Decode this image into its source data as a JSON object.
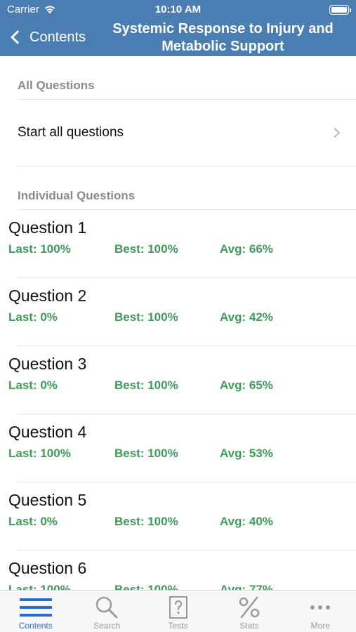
{
  "status_bar": {
    "carrier": "Carrier",
    "time": "10:10 AM"
  },
  "nav": {
    "back_label": "Contents",
    "title": "Systemic Response to Injury and Metabolic Support"
  },
  "sections": {
    "all_header": "All Questions",
    "start_all_label": "Start all questions",
    "individual_header": "Individual Questions"
  },
  "questions": [
    {
      "title": "Question 1",
      "last": "Last: 100%",
      "best": "Best: 100%",
      "avg": "Avg: 66%"
    },
    {
      "title": "Question 2",
      "last": "Last: 0%",
      "best": "Best: 100%",
      "avg": "Avg: 42%"
    },
    {
      "title": "Question 3",
      "last": "Last: 0%",
      "best": "Best: 100%",
      "avg": "Avg: 65%"
    },
    {
      "title": "Question 4",
      "last": "Last: 100%",
      "best": "Best: 100%",
      "avg": "Avg: 53%"
    },
    {
      "title": "Question 5",
      "last": "Last: 0%",
      "best": "Best: 100%",
      "avg": "Avg: 40%"
    },
    {
      "title": "Question 6",
      "last": "Last: 100%",
      "best": "Best: 100%",
      "avg": "Avg: 77%"
    }
  ],
  "tabs": [
    {
      "label": "Contents",
      "icon": "list-icon",
      "active": true
    },
    {
      "label": "Search",
      "icon": "search-icon",
      "active": false
    },
    {
      "label": "Tests",
      "icon": "test-icon",
      "active": false
    },
    {
      "label": "Stats",
      "icon": "percent-icon",
      "active": false
    },
    {
      "label": "More",
      "icon": "more-icon",
      "active": false
    }
  ],
  "colors": {
    "nav_bg": "#4a7eb3",
    "stat_green": "#3e9b5a",
    "tab_active": "#2b6ed1",
    "tab_inactive": "#9a9a9a"
  }
}
